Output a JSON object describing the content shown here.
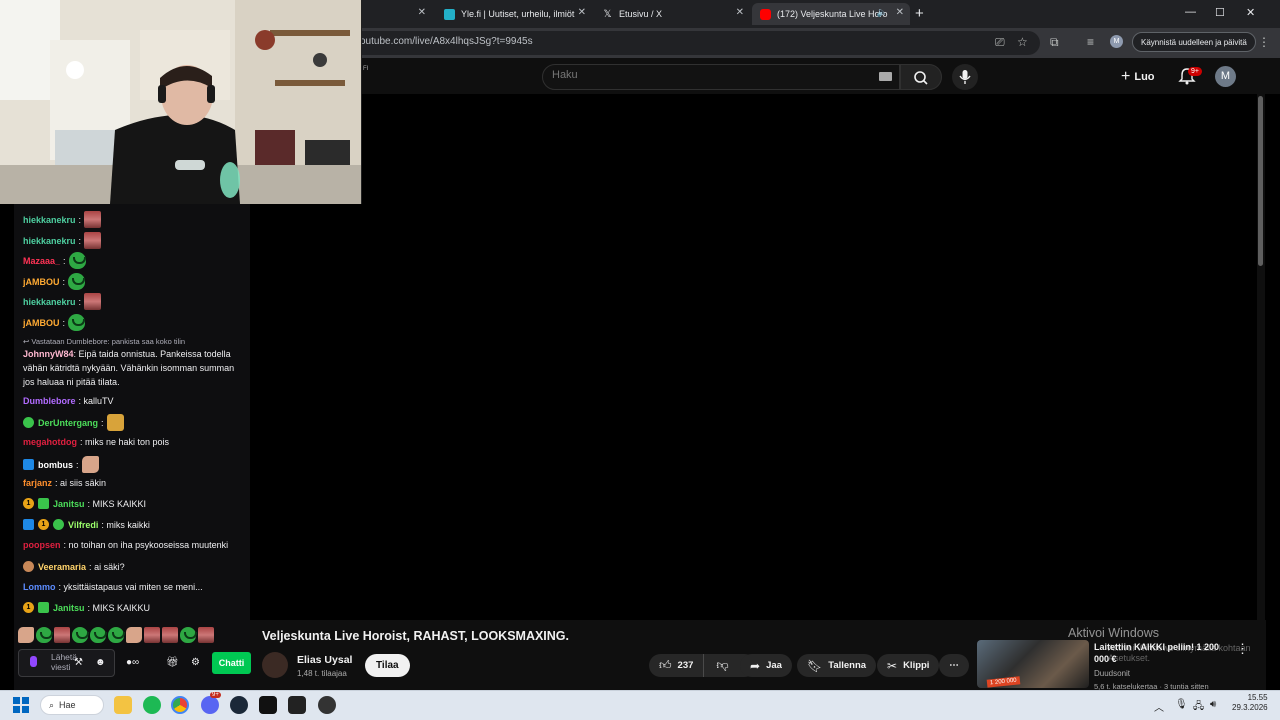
{
  "browser": {
    "tabs": [
      {
        "title": "",
        "icon": "generic-tab-icon"
      },
      {
        "title": "Yle.fi | Uutiset, urheilu, ilmiöt",
        "icon": "yle-icon"
      },
      {
        "title": "Etusivu / X",
        "icon": "x-icon"
      },
      {
        "title": "(172) Veljeskunta Live Horo",
        "icon": "youtube-icon"
      }
    ],
    "url": "outube.com/live/A8x4lhqsJSg?t=9945s",
    "restart_label": "Käynnistä uudelleen ja päivitä",
    "profile_initial": "M"
  },
  "youtube": {
    "region": "FI",
    "search_placeholder": "Haku",
    "create_label": "Luo",
    "notification_count": "9+",
    "avatar_initial": "M",
    "video_title": "Veljeskunta Live Horoist, RAHAST, LOOKSMAXING.",
    "channel_name": "Elias Uysal",
    "subscribers": "1,48 t. tilaajaa",
    "subscribe_label": "Tilaa",
    "likes": "237",
    "share_label": "Jaa",
    "save_label": "Tallenna",
    "clip_label": "Klippi",
    "recommended": {
      "title": "Laitettiin KAIKKI peliin! 1 200 000 €",
      "channel": "Duudsonit",
      "meta": "5,6 t. katselukertaa · 3 tuntia sitten",
      "thumb_tag": "1 200 000"
    },
    "windows_watermark": "Aktivoi Windows",
    "windows_watermark_sub": "Aktivoi Windows siirtymällä kohtaan Asetukset."
  },
  "chat": {
    "messages": [
      {
        "user": "hiekkanekru",
        "color": "#4ecfa0",
        "text": "",
        "emote": "face"
      },
      {
        "user": "hiekkanekru",
        "color": "#4ecfa0",
        "text": "",
        "emote": "face"
      },
      {
        "user": "Mazaaa_",
        "color": "#ff3355",
        "text": "",
        "emote": "pepe"
      },
      {
        "user": "jAMBOU",
        "color": "#ffaa33",
        "text": "",
        "emote": "pepe"
      },
      {
        "user": "hiekkanekru",
        "color": "#4ecfa0",
        "text": "",
        "emote": "face"
      },
      {
        "user": "jAMBOU",
        "color": "#ffaa33",
        "text": "",
        "emote": "pepe"
      }
    ],
    "reply_ref": "Vastataan Dumblebore: pankista saa koko tilin",
    "reply_user": "JohnnyW84",
    "reply_text": "Eipä taida onnistua. Pankeissa todella vähän kätridtä nykyään. Vähänkin isomman summan jos haluaa ni pitää tilata.",
    "messages2": [
      {
        "user": "Dumblebore",
        "color": "#b16bff",
        "text": "kalluTV"
      },
      {
        "user": "DerUntergang",
        "color": "#4cdd5a",
        "text": ""
      },
      {
        "user": "megahotdog",
        "color": "#e02040",
        "text": "miks ne haki ton pois"
      },
      {
        "user": "bombus",
        "color": "#ffffff",
        "text": ""
      },
      {
        "user": "farjanz",
        "color": "#ff8f2d",
        "text": "ai siis säkin"
      },
      {
        "user": "Janitsu",
        "color": "#4cdd5a",
        "text": "MIKS KAIKKI"
      },
      {
        "user": "Vilfredi",
        "color": "#9cff6b",
        "text": "miks kaikki"
      },
      {
        "user": "poopsen",
        "color": "#e02040",
        "text": "no toihan on iha psykooseissa muutenki"
      },
      {
        "user": "Veeramaria",
        "color": "#ffd36b",
        "text": "ai säki?"
      },
      {
        "user": "Lommo",
        "color": "#5c8cff",
        "text": "yksittäistapaus vai miten se meni..."
      },
      {
        "user": "Janitsu",
        "color": "#4cdd5a",
        "text": "MIKS KAIKKU"
      }
    ],
    "input_placeholder": "Lähetä viesti",
    "send_label": "Chatti"
  },
  "taskbar": {
    "search_label": "Hae",
    "discord_badge": "9+",
    "time": "15.55",
    "date": "29.3.2026"
  },
  "colors": {
    "accent_red": "#cc0000",
    "chat_send_green": "#00c853",
    "twitch_purple": "#9147ff"
  }
}
